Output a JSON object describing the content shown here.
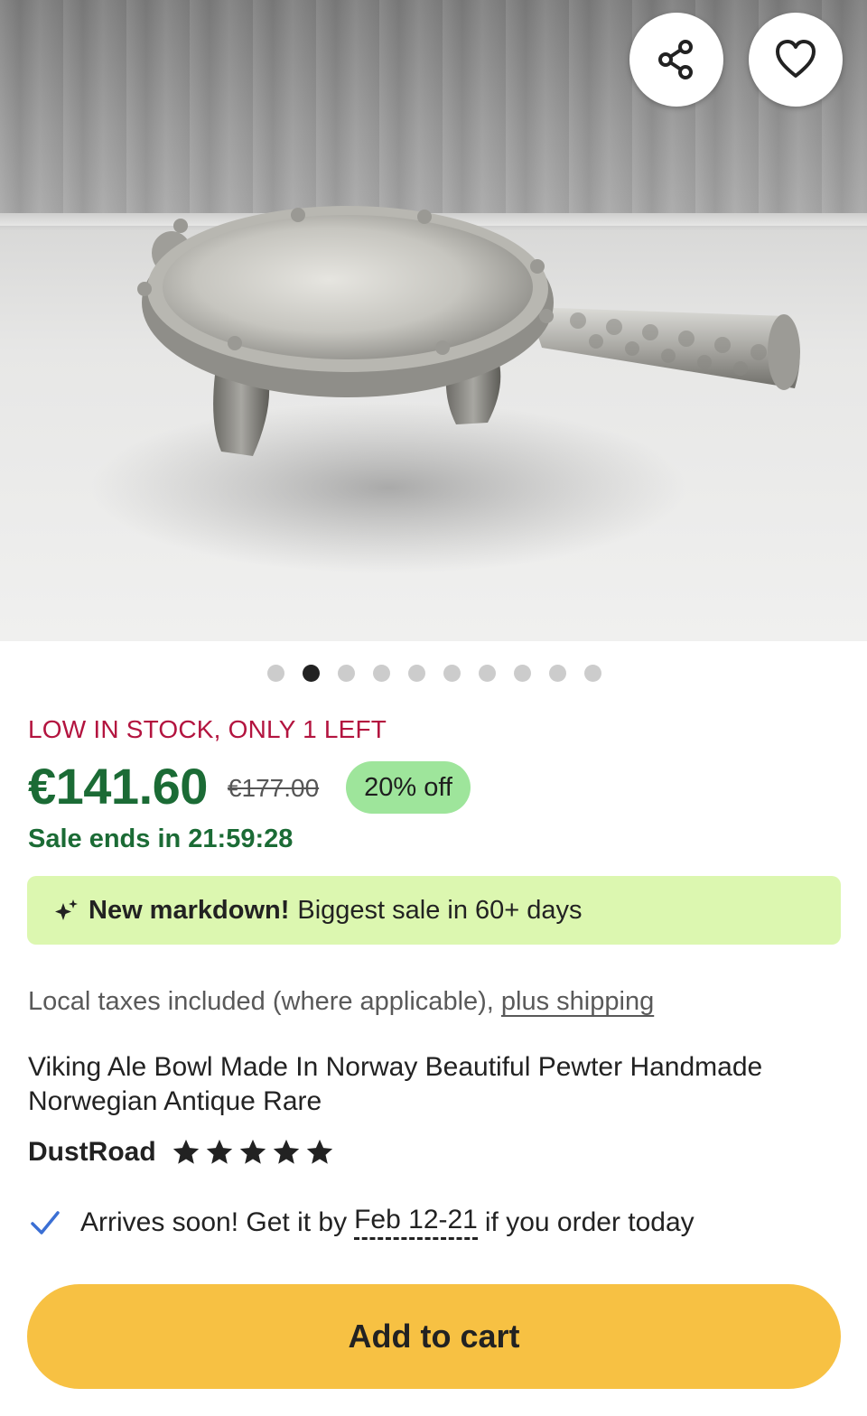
{
  "image": {
    "description_icon": "product-photo",
    "carousel": {
      "total": 10,
      "active_index": 1
    }
  },
  "actions": {
    "share_icon": "share-icon",
    "favorite_icon": "heart-icon"
  },
  "stock_notice": "LOW IN STOCK, ONLY 1 LEFT",
  "pricing": {
    "price": "€141.60",
    "original_price": "€177.00",
    "discount": "20% off",
    "sale_ends": "Sale ends in 21:59:28"
  },
  "markdown_banner": {
    "icon": "sparkle-icon",
    "highlight": "New markdown!",
    "text": "Biggest sale in 60+ days"
  },
  "taxes": {
    "text": "Local taxes included (where applicable),",
    "link": "plus shipping"
  },
  "title": "Viking Ale Bowl Made In Norway Beautiful Pewter Handmade Norwegian Antique Rare",
  "seller": {
    "name": "DustRoad",
    "rating": 5
  },
  "delivery": {
    "icon": "checkmark-icon",
    "prefix": "Arrives soon! Get it by",
    "dates": "Feb 12-21",
    "suffix": "if you order today"
  },
  "cart_button": "Add to cart",
  "colors": {
    "price_green": "#1b6b35",
    "stock_red": "#b3143f",
    "badge_green": "#9ee59b",
    "banner_green": "#dcf7b0",
    "cart_yellow": "#f7c143",
    "check_blue": "#3b6fd4"
  }
}
